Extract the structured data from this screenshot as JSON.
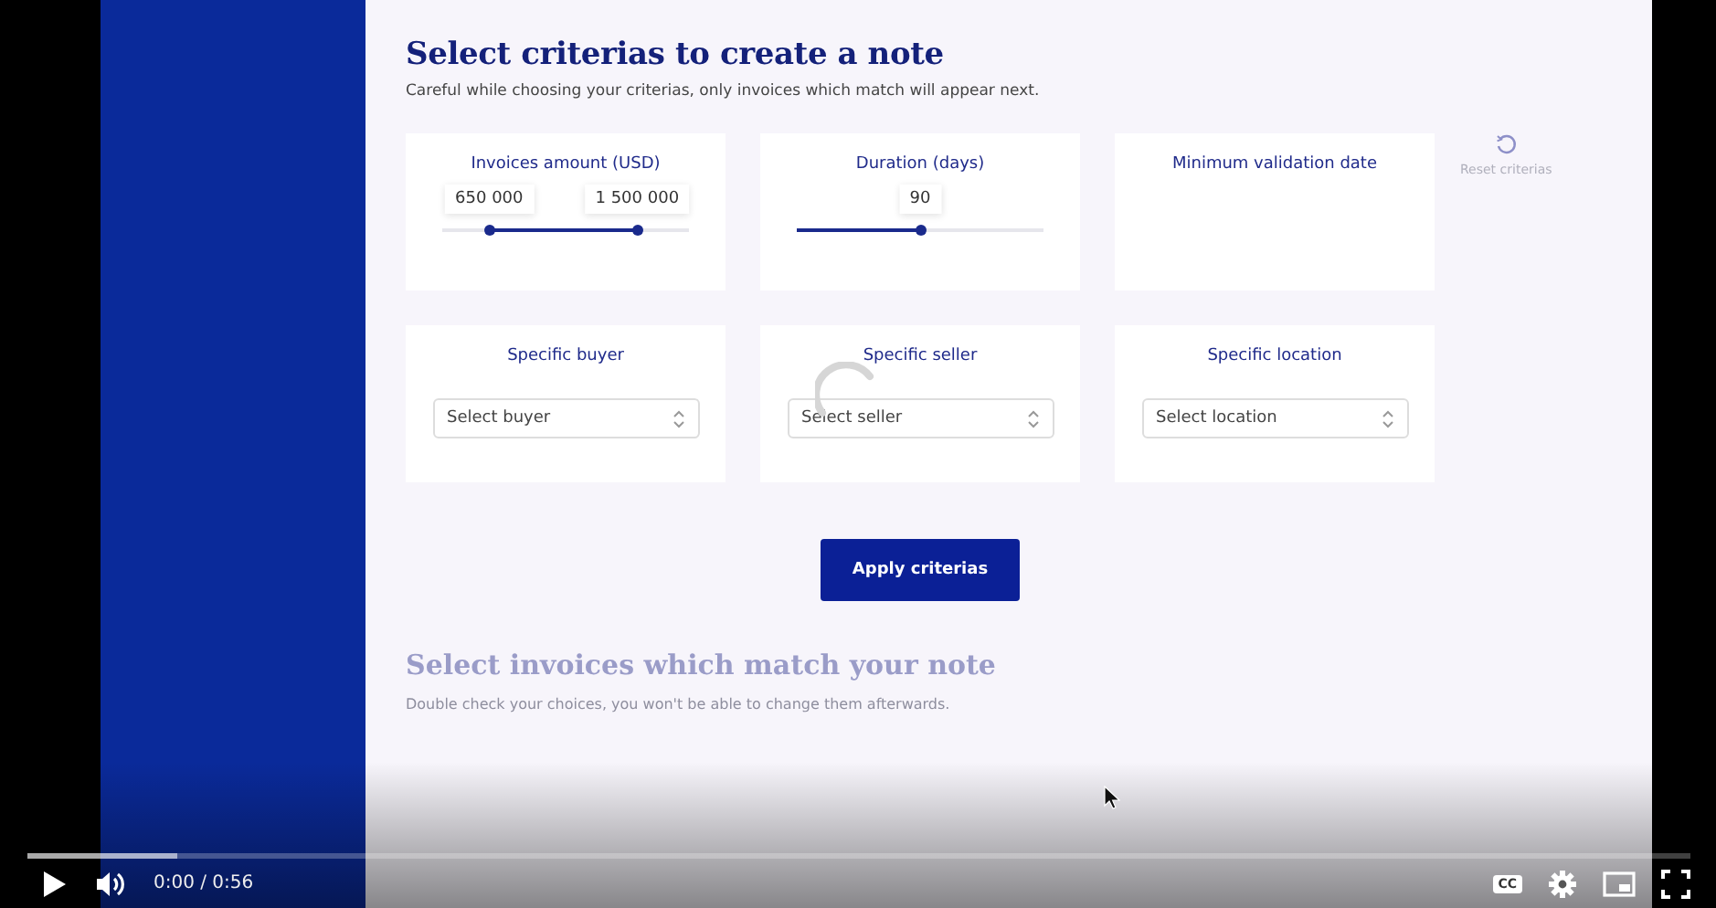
{
  "page": {
    "title": "Select criterias to create a note",
    "subtitle": "Careful while choosing your criterias, only invoices which match will appear next.",
    "criteria": [
      {
        "kind": "range",
        "label": "Invoices amount (USD)",
        "handles": [
          {
            "value": "650 000",
            "level": 0.19
          },
          {
            "value": "1 500 000",
            "level": 0.79
          }
        ]
      },
      {
        "kind": "range",
        "label": "Duration (days)",
        "handles": [
          {
            "value": "90",
            "level": 0.5
          }
        ]
      },
      {
        "kind": "date",
        "label": "Minimum validation date"
      },
      {
        "kind": "select",
        "label": "Specific buyer",
        "placeholder": "Select buyer",
        "loading": false
      },
      {
        "kind": "select",
        "label": "Specific seller",
        "placeholder": "Select seller",
        "loading": true
      },
      {
        "kind": "select",
        "label": "Specific location",
        "placeholder": "Select location",
        "loading": false
      }
    ],
    "reset": "Reset criterias",
    "apply": "Apply criterias",
    "next_title": "Select invoices which match your note",
    "next_subtitle": "Double check your choices, you won't be able to change them afterwards."
  },
  "player": {
    "level": 0.09,
    "time": "0:00 / 0:56",
    "captions": "CC"
  }
}
